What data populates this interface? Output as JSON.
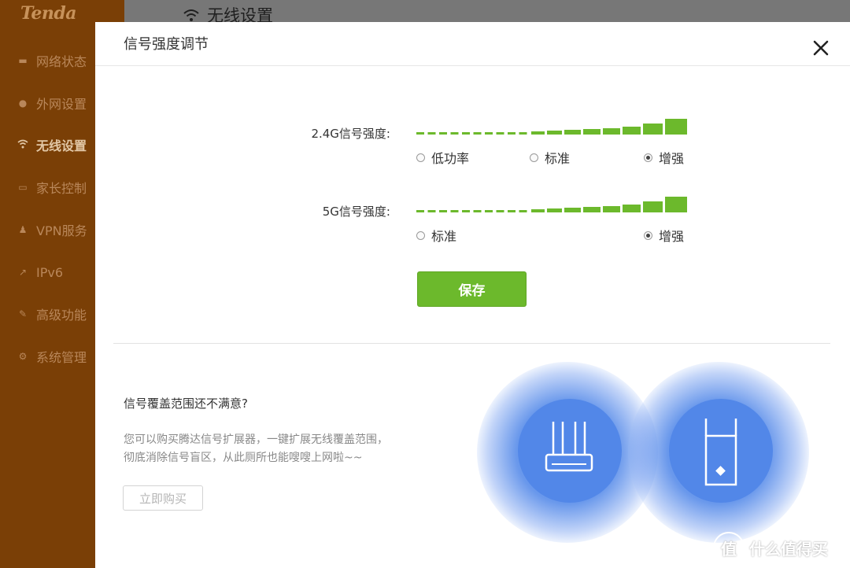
{
  "app": {
    "logo": "Tenda",
    "page_title": "无线设置",
    "sidebar": [
      {
        "label": "网络状态",
        "icon": "network-status-icon",
        "active": false
      },
      {
        "label": "外网设置",
        "icon": "globe-icon",
        "active": false
      },
      {
        "label": "无线设置",
        "icon": "wifi-icon",
        "active": true
      },
      {
        "label": "家长控制",
        "icon": "parental-control-icon",
        "active": false
      },
      {
        "label": "VPN服务",
        "icon": "vpn-icon",
        "active": false
      },
      {
        "label": "IPv6",
        "icon": "ipv6-icon",
        "active": false
      },
      {
        "label": "高级功能",
        "icon": "wrench-icon",
        "active": false
      },
      {
        "label": "系统管理",
        "icon": "gear-icon",
        "active": false
      }
    ]
  },
  "modal": {
    "title": "信号强度调节",
    "close_icon": "close-icon",
    "band_24g": {
      "label": "2.4G信号强度:",
      "options": [
        "低功率",
        "标准",
        "增强"
      ],
      "selected": "增强"
    },
    "band_5g": {
      "label": "5G信号强度:",
      "options": [
        "标准",
        "增强"
      ],
      "selected": "增强"
    },
    "save_label": "保存",
    "promo": {
      "title": "信号覆盖范围还不满意?",
      "desc_line1": "您可以购买腾达信号扩展器，一键扩展无线覆盖范围，",
      "desc_line2": "彻底消除信号盲区，从此厕所也能嗖嗖上网啦~~",
      "buy_label": "立即购买"
    }
  },
  "watermark": {
    "text": "什么值得买",
    "icon_text": "值"
  },
  "colors": {
    "accent_green": "#6cb92c",
    "sidebar_bg": "#7a3f06",
    "circle_blue": "#4f86e8"
  }
}
